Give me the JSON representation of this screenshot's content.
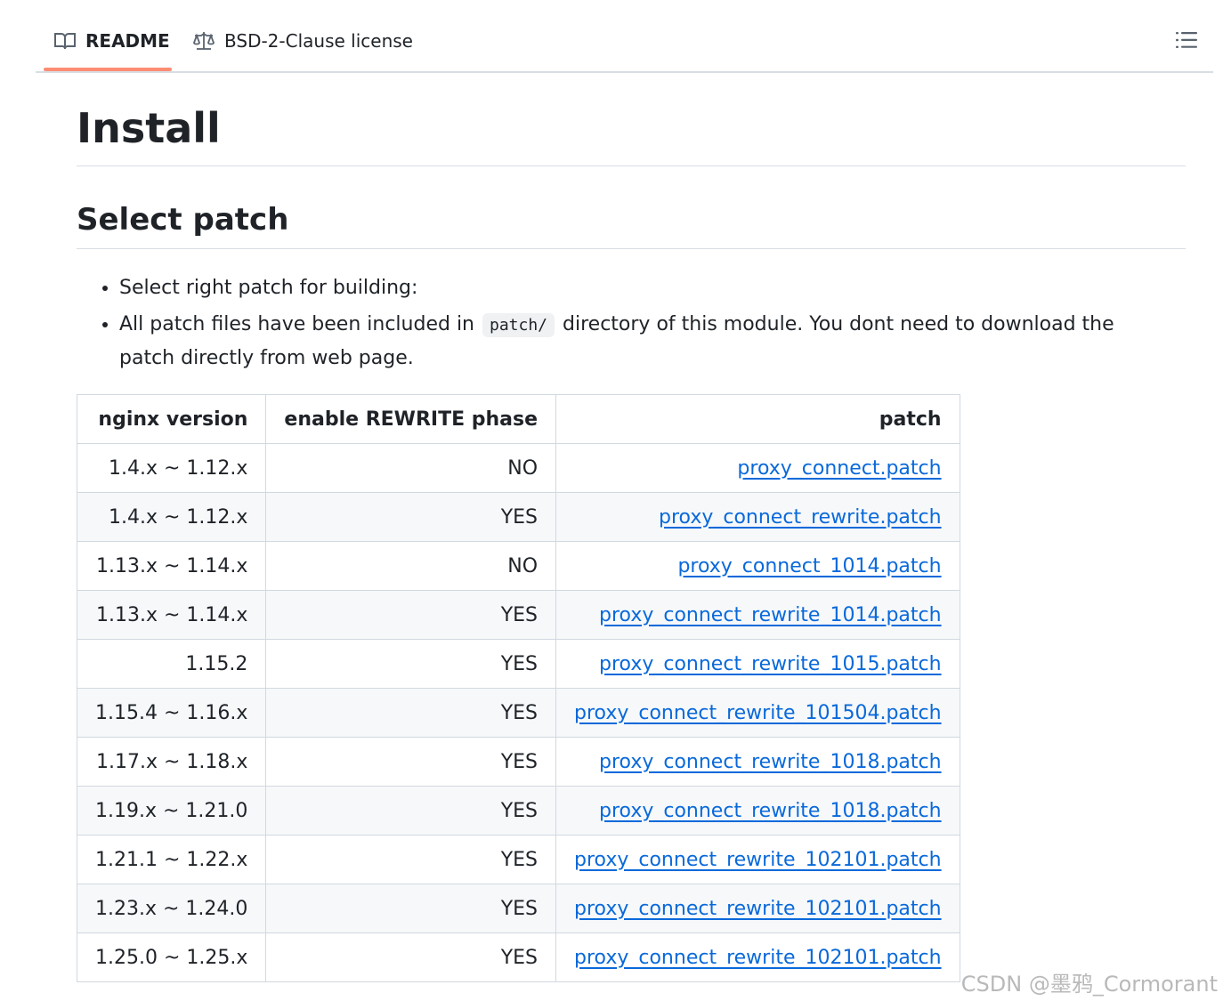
{
  "tabs": {
    "readme_label": "README",
    "license_label": "BSD-2-Clause license",
    "readme_icon": "book-icon",
    "license_icon": "law-scale-icon",
    "outline_icon": "list-unordered-icon",
    "active_tab_color": "#fd8c73"
  },
  "content": {
    "title": "Install",
    "section_title": "Select patch",
    "bullet1": "Select right patch for building:",
    "bullet2_before": "All patch files have been included in",
    "bullet2_code": "patch/",
    "bullet2_after": "directory of this module. You dont need to download the patch directly from web page."
  },
  "table": {
    "headers": [
      "nginx version",
      "enable REWRITE phase",
      "patch"
    ],
    "rows": [
      [
        "1.4.x ~ 1.12.x",
        "NO",
        "proxy_connect.patch"
      ],
      [
        "1.4.x ~ 1.12.x",
        "YES",
        "proxy_connect_rewrite.patch"
      ],
      [
        "1.13.x ~ 1.14.x",
        "NO",
        "proxy_connect_1014.patch"
      ],
      [
        "1.13.x ~ 1.14.x",
        "YES",
        "proxy_connect_rewrite_1014.patch"
      ],
      [
        "1.15.2",
        "YES",
        "proxy_connect_rewrite_1015.patch"
      ],
      [
        "1.15.4 ~ 1.16.x",
        "YES",
        "proxy_connect_rewrite_101504.patch"
      ],
      [
        "1.17.x ~ 1.18.x",
        "YES",
        "proxy_connect_rewrite_1018.patch"
      ],
      [
        "1.19.x ~ 1.21.0",
        "YES",
        "proxy_connect_rewrite_1018.patch"
      ],
      [
        "1.21.1 ~ 1.22.x",
        "YES",
        "proxy_connect_rewrite_102101.patch"
      ],
      [
        "1.23.x ~ 1.24.0",
        "YES",
        "proxy_connect_rewrite_102101.patch"
      ],
      [
        "1.25.0 ~ 1.25.x",
        "YES",
        "proxy_connect_rewrite_102101.patch"
      ]
    ],
    "link_color": "#0969da"
  },
  "watermark": "CSDN @墨鸦_Cormorant"
}
